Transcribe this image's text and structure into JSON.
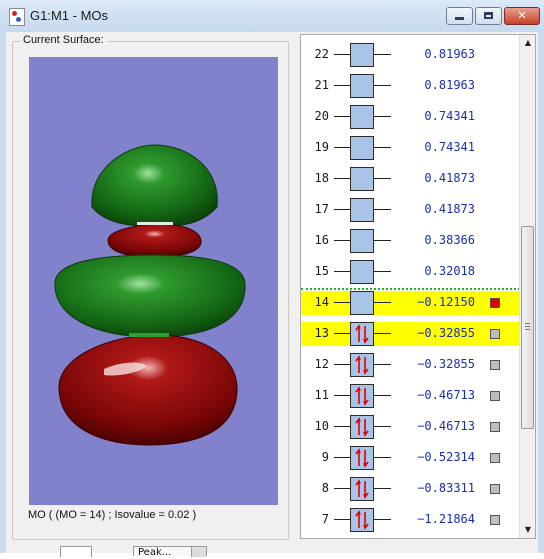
{
  "window": {
    "title": "G1:M1 - MOs",
    "minimize_label": "–",
    "maximize_label": "□",
    "close_label": "✕"
  },
  "surface": {
    "group_label": "Current Surface:",
    "status": "MO ( (MO = 14) ; Isovalue = 0.02 )",
    "colors": {
      "background": "#8282cc",
      "positive_lobe": "#1f7a1f",
      "negative_lobe": "#8a0a0a"
    }
  },
  "mo_list": {
    "items": [
      {
        "num": "22",
        "energy": "0.81963",
        "occupied": false,
        "selected": false,
        "swatch": null
      },
      {
        "num": "21",
        "energy": "0.81963",
        "occupied": false,
        "selected": false,
        "swatch": null
      },
      {
        "num": "20",
        "energy": "0.74341",
        "occupied": false,
        "selected": false,
        "swatch": null
      },
      {
        "num": "19",
        "energy": "0.74341",
        "occupied": false,
        "selected": false,
        "swatch": null
      },
      {
        "num": "18",
        "energy": "0.41873",
        "occupied": false,
        "selected": false,
        "swatch": null
      },
      {
        "num": "17",
        "energy": "0.41873",
        "occupied": false,
        "selected": false,
        "swatch": null
      },
      {
        "num": "16",
        "energy": "0.38366",
        "occupied": false,
        "selected": false,
        "swatch": null
      },
      {
        "num": "15",
        "energy": "0.32018",
        "occupied": false,
        "selected": false,
        "swatch": null
      },
      {
        "num": "14",
        "energy": "-0.12150",
        "occupied": false,
        "selected": true,
        "swatch": "#e00000"
      },
      {
        "num": "13",
        "energy": "-0.32855",
        "occupied": true,
        "selected": true,
        "swatch": "#bdbdbd"
      },
      {
        "num": "12",
        "energy": "-0.32855",
        "occupied": true,
        "selected": false,
        "swatch": "#bdbdbd"
      },
      {
        "num": "11",
        "energy": "-0.46713",
        "occupied": true,
        "selected": false,
        "swatch": "#bdbdbd"
      },
      {
        "num": "10",
        "energy": "-0.46713",
        "occupied": true,
        "selected": false,
        "swatch": "#bdbdbd"
      },
      {
        "num": "9",
        "energy": "-0.52314",
        "occupied": true,
        "selected": false,
        "swatch": "#bdbdbd"
      },
      {
        "num": "8",
        "energy": "-0.83311",
        "occupied": true,
        "selected": false,
        "swatch": "#bdbdbd"
      },
      {
        "num": "7",
        "energy": "-1.21864",
        "occupied": true,
        "selected": false,
        "swatch": "#bdbdbd"
      }
    ],
    "colors": {
      "energy_text": "#1c2fb0",
      "box_fill": "#a9c4e6",
      "electron_arrow": "#e00000",
      "highlight": "#ffff00",
      "homo_lumo_line": "#1db51d"
    }
  },
  "bottom": {
    "combo_value": "Peak..."
  }
}
